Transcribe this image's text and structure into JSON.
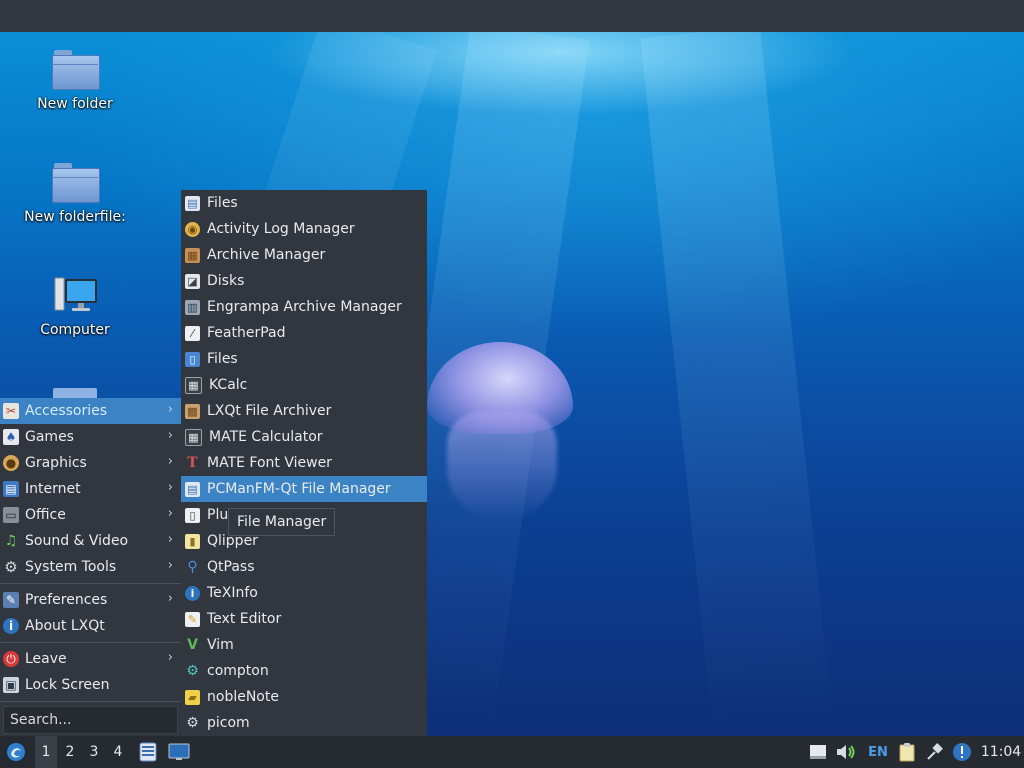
{
  "desktop": {
    "icons": [
      {
        "label": "New folder",
        "icon": "folder-icon"
      },
      {
        "label": "New folderfile:",
        "icon": "folder-icon"
      },
      {
        "label": "Computer",
        "icon": "computer-icon"
      }
    ]
  },
  "main_menu": {
    "categories": [
      {
        "label": "Accessories",
        "icon": "accessories-icon",
        "active": true
      },
      {
        "label": "Games",
        "icon": "games-icon"
      },
      {
        "label": "Graphics",
        "icon": "graphics-icon"
      },
      {
        "label": "Internet",
        "icon": "internet-icon"
      },
      {
        "label": "Office",
        "icon": "office-icon"
      },
      {
        "label": "Sound & Video",
        "icon": "sound-video-icon"
      },
      {
        "label": "System Tools",
        "icon": "system-tools-icon"
      }
    ],
    "settings": [
      {
        "label": "Preferences",
        "icon": "preferences-icon"
      },
      {
        "label": "About LXQt",
        "icon": "about-icon"
      }
    ],
    "session": [
      {
        "label": "Leave",
        "icon": "leave-icon"
      },
      {
        "label": "Lock Screen",
        "icon": "lock-screen-icon"
      }
    ],
    "search_placeholder": "Search..."
  },
  "submenu": {
    "items": [
      {
        "label": "Files",
        "icon": "files-icon"
      },
      {
        "label": "Activity Log Manager",
        "icon": "activity-log-icon"
      },
      {
        "label": "Archive Manager",
        "icon": "archive-manager-icon"
      },
      {
        "label": "Disks",
        "icon": "disks-icon"
      },
      {
        "label": "Engrampa Archive Manager",
        "icon": "engrampa-icon"
      },
      {
        "label": "FeatherPad",
        "icon": "featherpad-icon"
      },
      {
        "label": "Files",
        "icon": "files-icon"
      },
      {
        "label": "KCalc",
        "icon": "kcalc-icon"
      },
      {
        "label": "LXQt File Archiver",
        "icon": "file-archiver-icon"
      },
      {
        "label": "MATE Calculator",
        "icon": "calculator-icon"
      },
      {
        "label": "MATE Font Viewer",
        "icon": "font-viewer-icon"
      },
      {
        "label": "PCManFM-Qt File Manager",
        "icon": "file-manager-icon",
        "highlighted": true
      },
      {
        "label": "Plu",
        "icon": "plugin-icon"
      },
      {
        "label": "Qlipper",
        "icon": "qlipper-icon"
      },
      {
        "label": "QtPass",
        "icon": "qtpass-icon"
      },
      {
        "label": "TeXInfo",
        "icon": "texinfo-icon"
      },
      {
        "label": "Text Editor",
        "icon": "text-editor-icon"
      },
      {
        "label": "Vim",
        "icon": "vim-icon"
      },
      {
        "label": "compton",
        "icon": "compton-icon"
      },
      {
        "label": "nobleNote",
        "icon": "noblenote-icon"
      },
      {
        "label": "picom",
        "icon": "picom-icon"
      }
    ]
  },
  "tooltip": {
    "text": "File Manager"
  },
  "taskbar": {
    "workspaces": [
      "1",
      "2",
      "3",
      "4"
    ],
    "active_workspace": "1",
    "language": "EN",
    "clock": "11:04"
  },
  "colors": {
    "menu_bg": "#31363f",
    "highlight": "#3b83c4",
    "taskbar_bg": "#262a31"
  }
}
